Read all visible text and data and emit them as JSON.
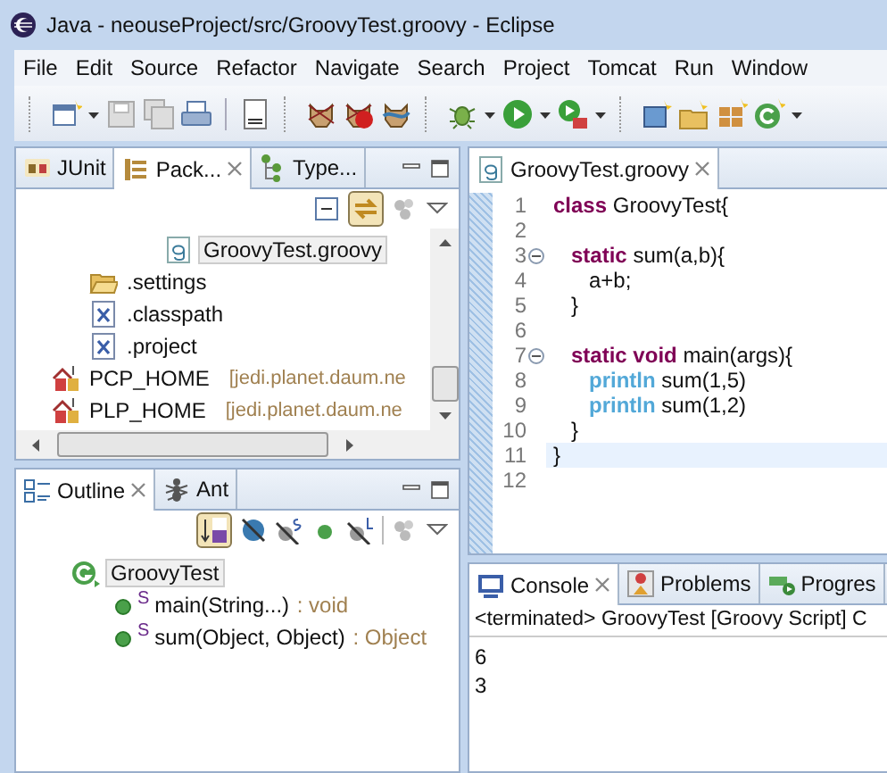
{
  "window": {
    "title": "Java - neouseProject/src/GroovyTest.groovy - Eclipse"
  },
  "menu": [
    "File",
    "Edit",
    "Source",
    "Refactor",
    "Navigate",
    "Search",
    "Project",
    "Tomcat",
    "Run",
    "Window"
  ],
  "package_panel": {
    "tabs": [
      {
        "label": "JUnit",
        "kind": "junit",
        "selected": false,
        "closable": false
      },
      {
        "label": "Pack...",
        "kind": "package",
        "selected": true,
        "closable": true
      },
      {
        "label": "Type...",
        "kind": "hierarchy",
        "selected": false,
        "closable": false
      }
    ],
    "link_with_editor": true,
    "tree": [
      {
        "children": [
          {
            "children": [
              {
                "children": [
                  {
                    "label": "GroovyTest.groovy",
                    "kind": "groovy-file",
                    "selected": true
                  }
                ]
              }
            ]
          },
          {
            "label": ".settings",
            "kind": "folder",
            "selected": false
          },
          {
            "label": ".classpath",
            "kind": "xml-file",
            "selected": false
          },
          {
            "label": ".project",
            "kind": "xml-file",
            "selected": false
          }
        ]
      },
      {
        "label": "PCP_HOME",
        "kind": "server",
        "decoration": "[jedi.planet.daum.ne",
        "selected": false
      },
      {
        "label": "PLP_HOME",
        "kind": "server",
        "decoration": "[jedi.planet.daum.ne",
        "selected": false
      }
    ]
  },
  "outline_panel": {
    "tabs": [
      {
        "label": "Outline",
        "kind": "outline",
        "selected": true,
        "closable": true
      },
      {
        "label": "Ant",
        "kind": "ant",
        "selected": false,
        "closable": false
      }
    ],
    "sort_on": true,
    "tree": [
      {
        "label": "GroovyTest",
        "kind": "class",
        "selected": true,
        "children": [
          {
            "label": "main(String...)",
            "kind": "method",
            "modifier": "S",
            "type": " : void",
            "selected": false
          },
          {
            "label": "sum(Object, Object)",
            "kind": "method",
            "modifier": "S",
            "type": " : Object",
            "selected": false
          }
        ]
      }
    ]
  },
  "editor": {
    "tabs": [
      {
        "label": "GroovyTest.groovy",
        "kind": "groovy-file",
        "selected": true,
        "closable": true
      }
    ],
    "lines": [
      {
        "number": "1",
        "foldable": false,
        "current": false,
        "tokens": [
          {
            "text": "class",
            "kind": "keyword"
          },
          {
            "text": " GroovyTest{",
            "kind": "plain"
          }
        ]
      },
      {
        "number": "2",
        "foldable": false,
        "current": false
      },
      {
        "number": "3",
        "foldable": true,
        "current": false,
        "tokens": [
          {
            "text": "   static",
            "kind": "keyword"
          },
          {
            "text": " sum(a,b){",
            "kind": "plain"
          }
        ]
      },
      {
        "number": "4",
        "foldable": false,
        "current": false,
        "tokens": [
          {
            "text": "      a+b;",
            "kind": "plain"
          }
        ]
      },
      {
        "number": "5",
        "foldable": false,
        "current": false,
        "tokens": [
          {
            "text": "   }",
            "kind": "plain"
          }
        ]
      },
      {
        "number": "6",
        "foldable": false,
        "current": false
      },
      {
        "number": "7",
        "foldable": true,
        "current": false,
        "tokens": [
          {
            "text": "   static void",
            "kind": "keyword"
          },
          {
            "text": " main(args){",
            "kind": "plain"
          }
        ]
      },
      {
        "number": "8",
        "foldable": false,
        "current": false,
        "tokens": [
          {
            "text": "      println",
            "kind": "builtin"
          },
          {
            "text": " sum(1,5)",
            "kind": "plain"
          }
        ]
      },
      {
        "number": "9",
        "foldable": false,
        "current": false,
        "tokens": [
          {
            "text": "      println",
            "kind": "builtin"
          },
          {
            "text": " sum(1,2)",
            "kind": "plain"
          }
        ]
      },
      {
        "number": "10",
        "foldable": false,
        "current": false,
        "tokens": [
          {
            "text": "   }",
            "kind": "plain"
          }
        ]
      },
      {
        "number": "11",
        "foldable": false,
        "current": true,
        "tokens": [
          {
            "text": "}",
            "kind": "plain"
          }
        ]
      },
      {
        "number": "12",
        "foldable": false,
        "current": false
      }
    ]
  },
  "console": {
    "tabs": [
      {
        "label": "Console",
        "kind": "console",
        "selected": true,
        "closable": true
      },
      {
        "label": "Problems",
        "kind": "problems",
        "selected": false,
        "closable": false
      },
      {
        "label": "Progres",
        "kind": "progress",
        "selected": false,
        "closable": false
      }
    ],
    "header": "<terminated> GroovyTest [Groovy Script] C",
    "output": [
      "6",
      "3"
    ]
  }
}
